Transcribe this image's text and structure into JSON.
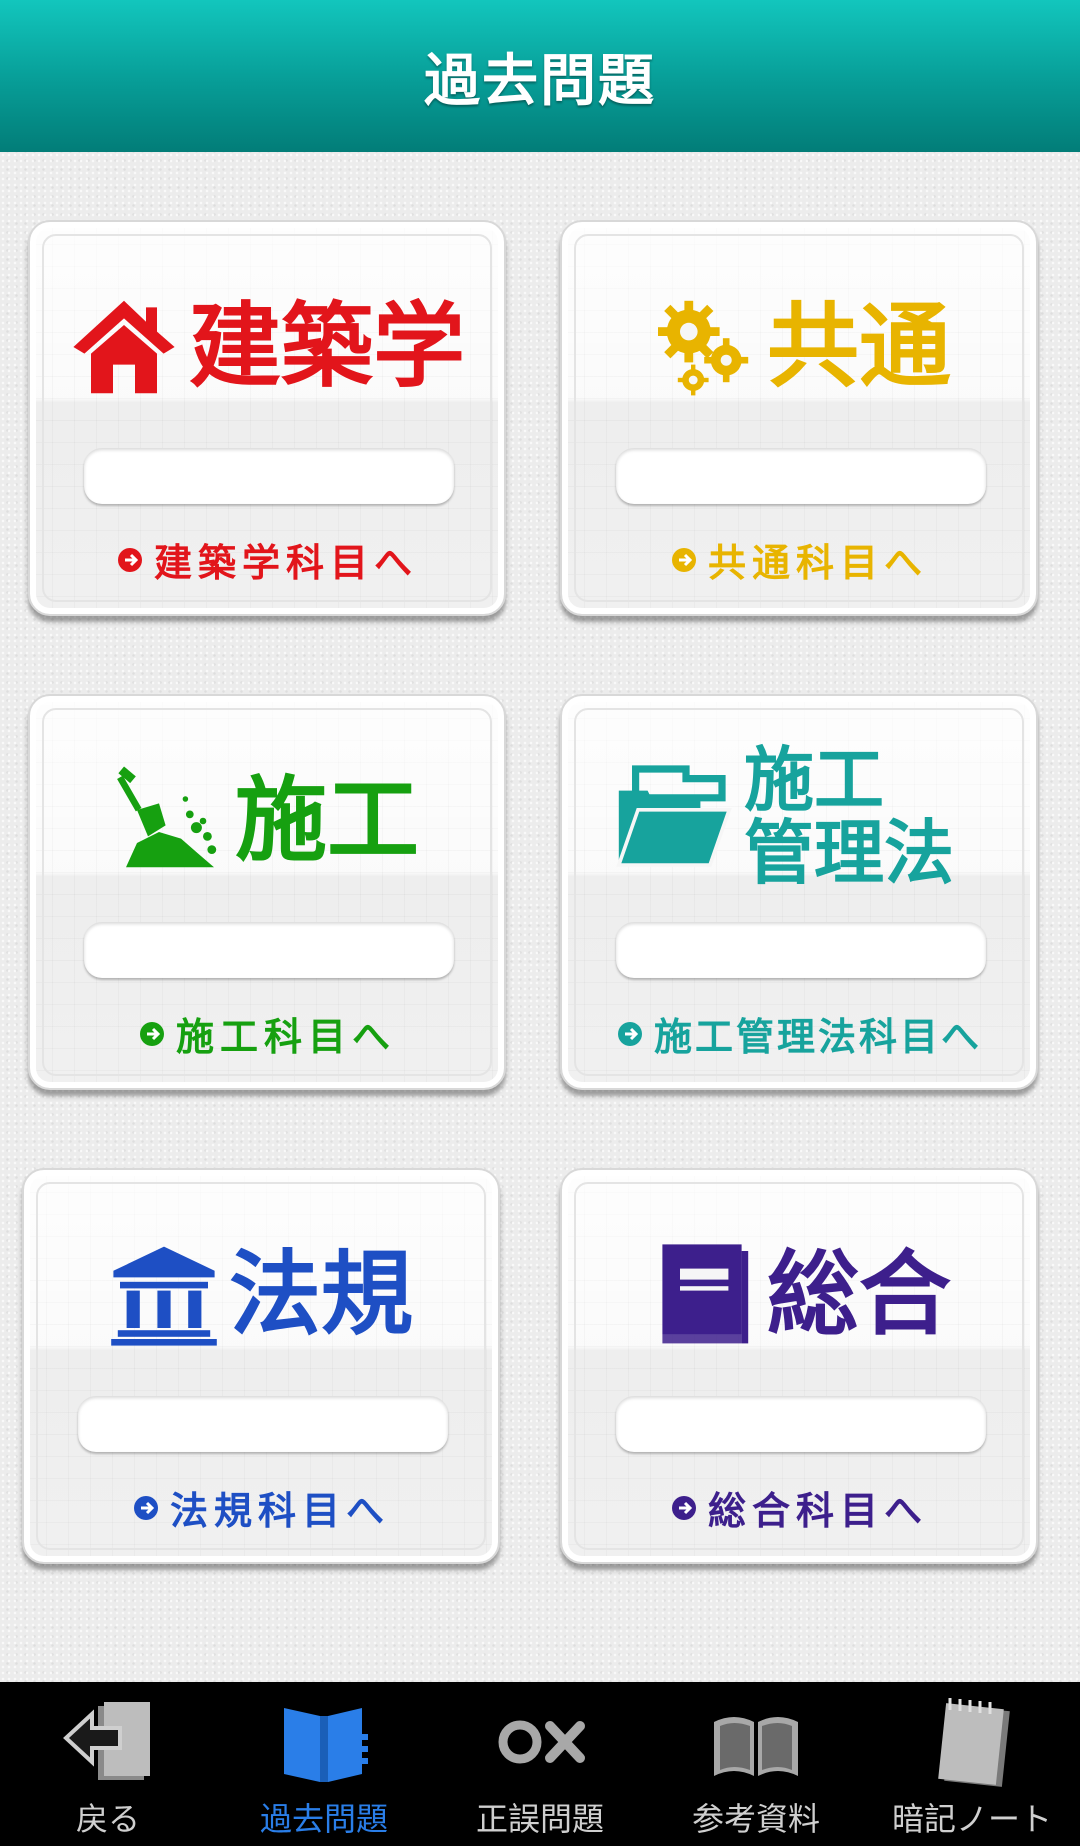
{
  "header": {
    "title": "過去問題"
  },
  "cards": [
    {
      "title": "建築学",
      "link": "建築学科目へ",
      "color": "#e2151b",
      "icon": "house-icon",
      "progress": 0
    },
    {
      "title": "共通",
      "link": "共通科目へ",
      "color": "#e8b400",
      "icon": "gears-icon",
      "progress": 0
    },
    {
      "title": "施工",
      "link": "施工科目へ",
      "color": "#16a010",
      "icon": "shovel-icon",
      "progress": 0
    },
    {
      "title": "施工\n管理法",
      "title_line1": "施工",
      "title_line2": "管理法",
      "link": "施工管理法科目へ",
      "color": "#17a39d",
      "icon": "folder-icon",
      "progress": 0
    },
    {
      "title": "法規",
      "link": "法規科目へ",
      "color": "#1e4fc4",
      "icon": "courthouse-icon",
      "progress": 0
    },
    {
      "title": "総合",
      "link": "総合科目へ",
      "color": "#3d1f8c",
      "icon": "book-icon",
      "progress": 0
    }
  ],
  "tabbar": {
    "items": [
      {
        "label": "戻る",
        "icon": "back-icon",
        "active": false
      },
      {
        "label": "過去問題",
        "icon": "open-book-icon",
        "active": true
      },
      {
        "label": "正誤問題",
        "icon": "circle-cross-icon",
        "active": false
      },
      {
        "label": "参考資料",
        "icon": "reference-book-icon",
        "active": false
      },
      {
        "label": "暗記ノート",
        "icon": "notebook-icon",
        "active": false
      }
    ]
  },
  "colors": {
    "header_top": "#12c6bd",
    "header_bottom": "#027d78",
    "tab_active": "#2a7ee8",
    "tab_inactive": "#cfcfcf"
  }
}
